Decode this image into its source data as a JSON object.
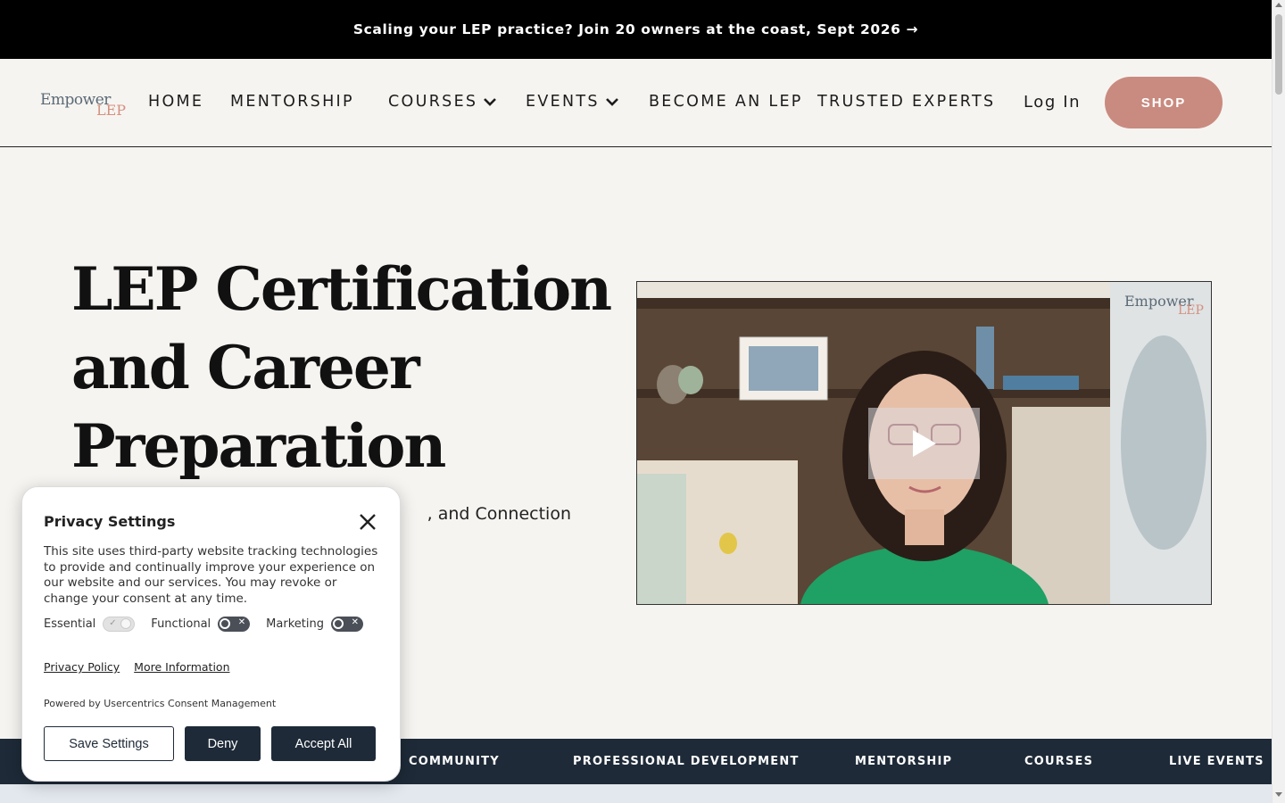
{
  "announcement": {
    "text": "Scaling your LEP practice? Join 20 owners at the coast, Sept 2026 →"
  },
  "header": {
    "logo": {
      "line1": "Empower",
      "line2": "LEP"
    },
    "nav": [
      {
        "label": "HOME"
      },
      {
        "label": "MENTORSHIP"
      },
      {
        "label": "COURSES",
        "has_dropdown": true
      },
      {
        "label": "EVENTS",
        "has_dropdown": true
      },
      {
        "label": "BECOME AN LEP"
      },
      {
        "label": "TRUSTED EXPERTS"
      }
    ],
    "login_label": "Log In",
    "shop_label": "SHOP"
  },
  "hero": {
    "title": "LEP Certification and Career Preparation Courses",
    "subtitle_visible": ", and Connection"
  },
  "video": {
    "logo_line1": "Empower",
    "logo_line2": "LEP"
  },
  "category_bar": {
    "items": [
      "COMMUNITY",
      "PROFESSIONAL DEVELOPMENT",
      "MENTORSHIP",
      "COURSES",
      "LIVE EVENTS"
    ]
  },
  "consent": {
    "title": "Privacy Settings",
    "body": "This site uses third-party website tracking technologies to provide and continually improve your experience on our website and our services. You may revoke or change your consent at any time.",
    "toggles": [
      {
        "label": "Essential",
        "state": "on",
        "disabled": true
      },
      {
        "label": "Functional",
        "state": "off"
      },
      {
        "label": "Marketing",
        "state": "off"
      }
    ],
    "privacy_policy_label": "Privacy Policy",
    "more_info_label": "More Information",
    "powered_by": "Powered by Usercentrics Consent Management",
    "save_label": "Save Settings",
    "deny_label": "Deny",
    "accept_label": "Accept All"
  },
  "colors": {
    "announcement_bg": "#000000",
    "page_bg": "#f6f4f1",
    "shop_button": "#c98b7f",
    "navy": "#1e2a38",
    "logo_slate": "#5b6a76",
    "logo_rose": "#d4907f"
  },
  "icons": {
    "dropdown": "chevron-down-icon",
    "play": "play-icon",
    "close": "close-icon"
  }
}
